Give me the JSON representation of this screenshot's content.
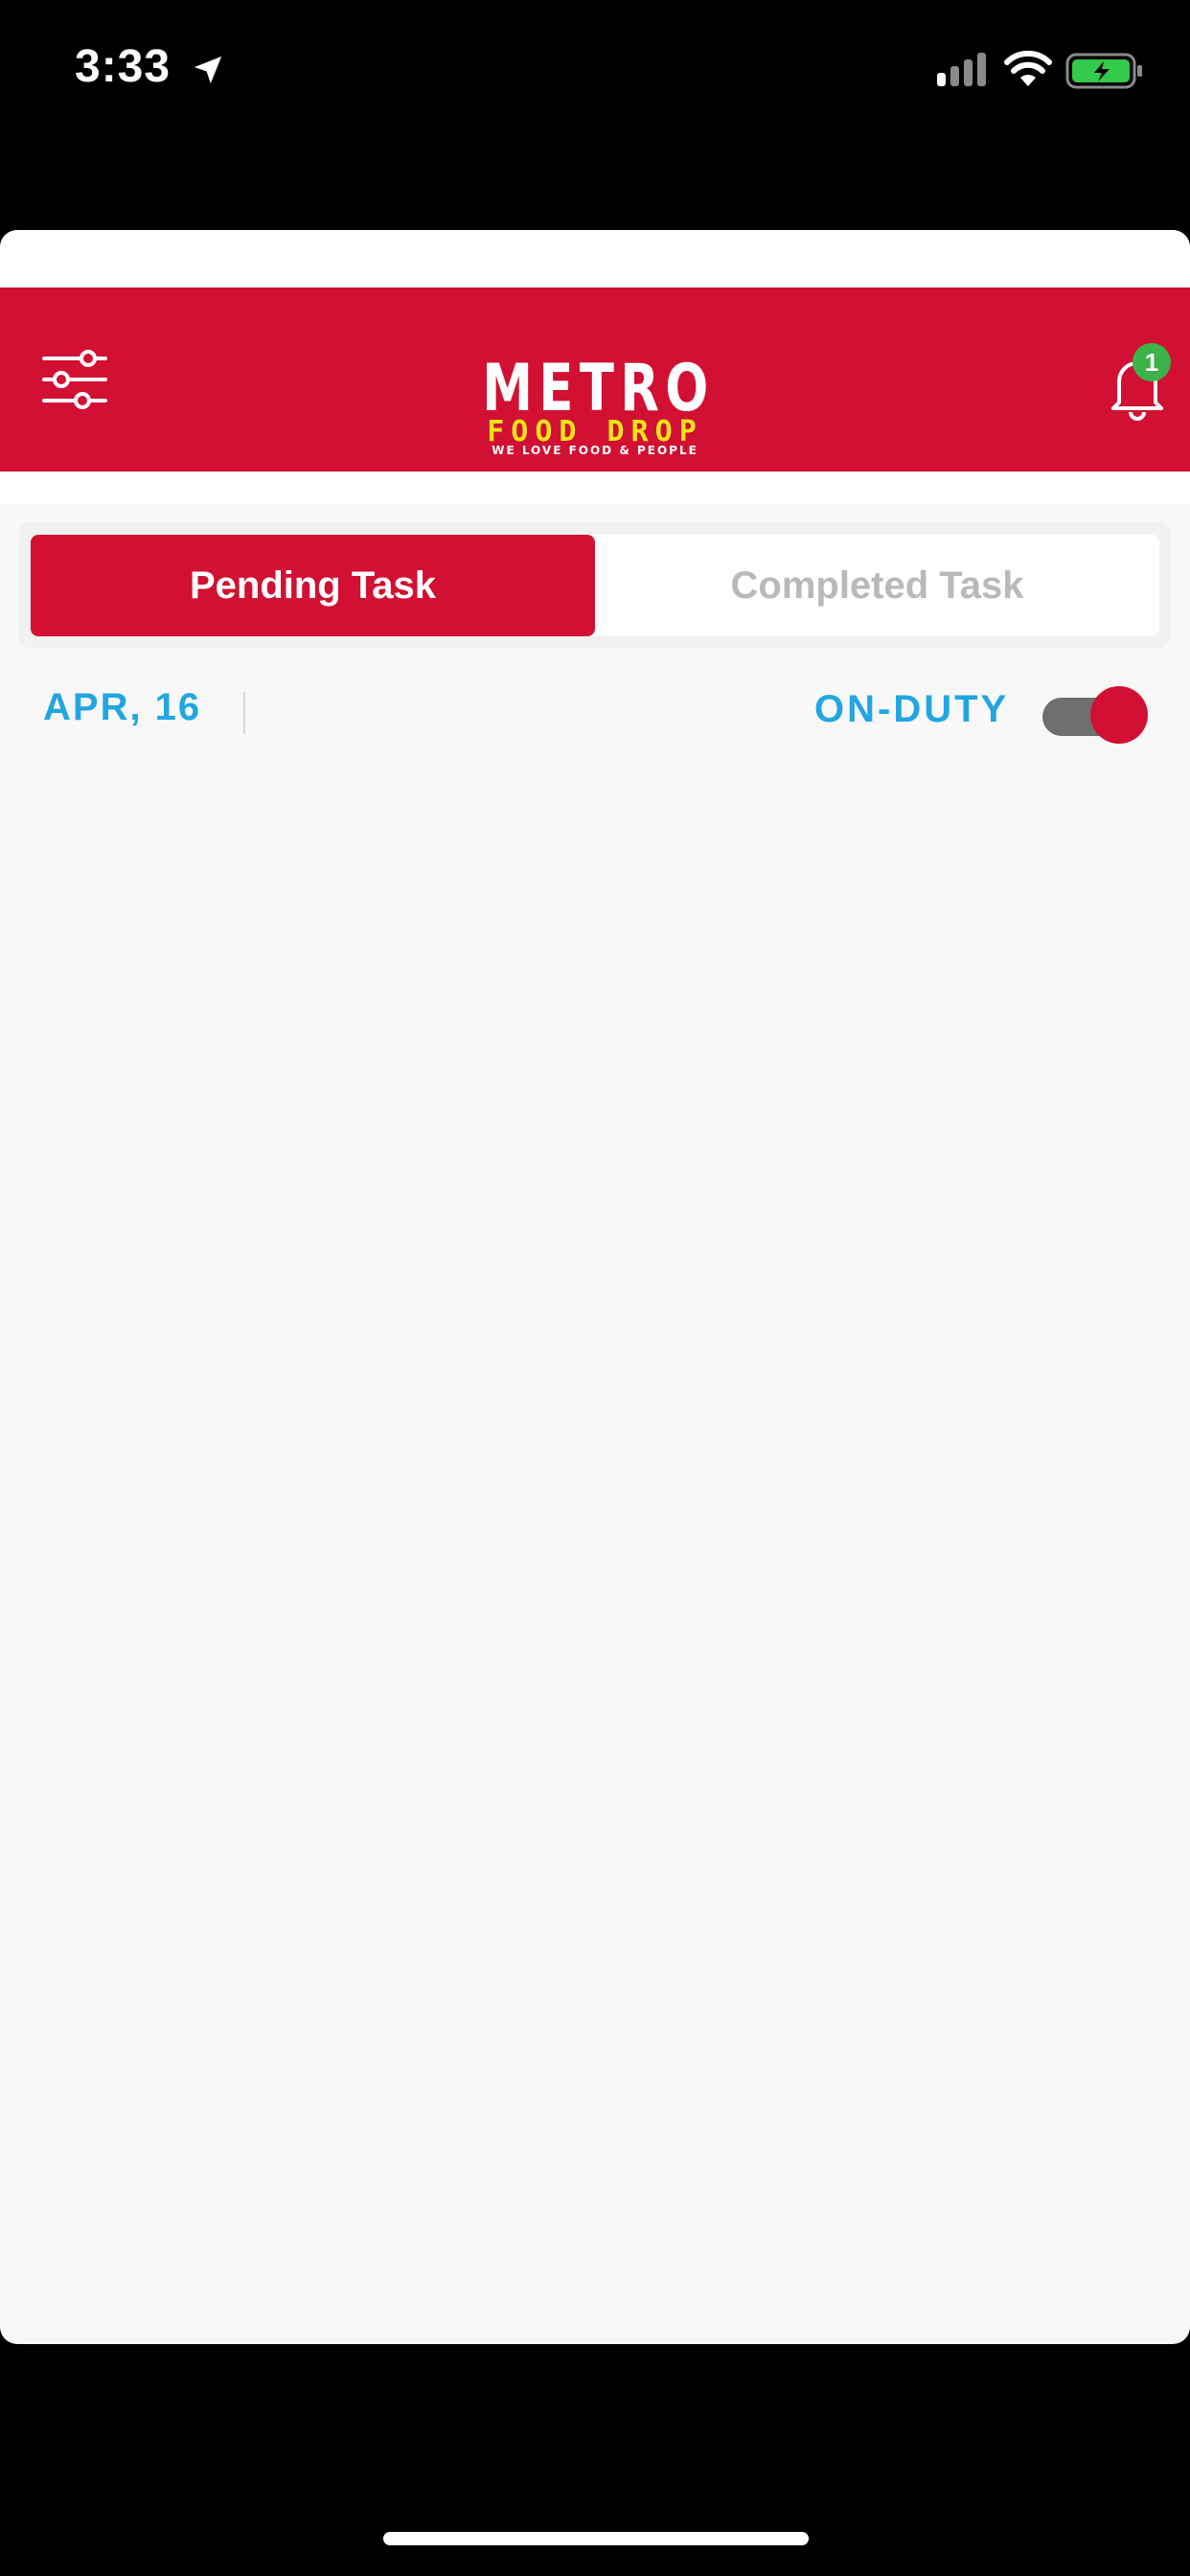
{
  "status_bar": {
    "time": "3:33",
    "icons": [
      "location-arrow-icon",
      "cellular-signal-icon",
      "wifi-icon",
      "battery-charging-icon"
    ]
  },
  "header": {
    "logo": {
      "line1": "METRO",
      "line2": "FOOD DROP",
      "line3": "WE LOVE FOOD & PEOPLE"
    },
    "filter_icon": "sliders-icon",
    "notification_icon": "bell-icon",
    "notification_count": "1"
  },
  "tabs": [
    {
      "label": "Pending Task",
      "active": true
    },
    {
      "label": "Completed Task",
      "active": false
    }
  ],
  "date_row": {
    "date": "APR, 16",
    "duty_label": "ON-DUTY",
    "duty_on": true
  },
  "colors": {
    "brand_red": "#d21033",
    "accent_blue": "#22a6e2",
    "logo_yellow": "#f2e21a",
    "badge_green": "#3bb34a",
    "inactive_tab_text": "#b9b9b9",
    "background": "#f8f8f8"
  }
}
